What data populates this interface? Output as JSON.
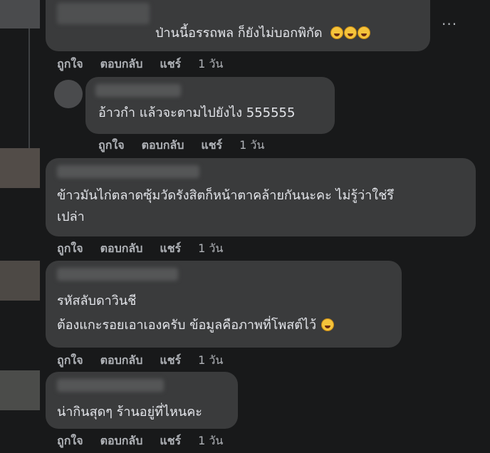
{
  "comments": [
    {
      "lines": [
        "ป่านนี้อรรถพล ก็ยังไม่บอกพิกัด"
      ],
      "emoji_count": 3,
      "actions": {
        "like": "ถูกใจ",
        "reply": "ตอบกลับ",
        "share": "แชร์",
        "time": "1 วัน"
      },
      "more_label": "···"
    },
    {
      "lines": [
        "อ้าวกำ แล้วจะตามไปยังไง 555555"
      ],
      "emoji_count": 0,
      "actions": {
        "like": "ถูกใจ",
        "reply": "ตอบกลับ",
        "share": "แชร์",
        "time": "1 วัน"
      }
    },
    {
      "lines": [
        "ข้าวมันไก่ตลาดซุ้มวัดรังสิตก็หน้าตาคล้ายกันนะคะ ไม่รู้ว่าใช่รึ",
        "เปล่า"
      ],
      "emoji_count": 0,
      "actions": {
        "like": "ถูกใจ",
        "reply": "ตอบกลับ",
        "share": "แชร์",
        "time": "1 วัน"
      }
    },
    {
      "lines": [
        "รหัสลับดาวินชี",
        "ต้องแกะรอยเอาเองครับ ข้อมูลคือภาพที่โพสต์ไว้"
      ],
      "emoji_count": 1,
      "actions": {
        "like": "ถูกใจ",
        "reply": "ตอบกลับ",
        "share": "แชร์",
        "time": "1 วัน"
      }
    },
    {
      "lines": [
        "น่ากินสุดๆ ร้านอยู่ที่ไหนคะ"
      ],
      "emoji_count": 0,
      "actions": {
        "like": "ถูกใจ",
        "reply": "ตอบกลับ",
        "share": "แชร์",
        "time": "1 วัน"
      }
    }
  ],
  "colors": {
    "background": "#18191a",
    "bubble": "#3a3b3c",
    "text": "#e4e6eb",
    "secondary_text": "#b0b3b8"
  }
}
